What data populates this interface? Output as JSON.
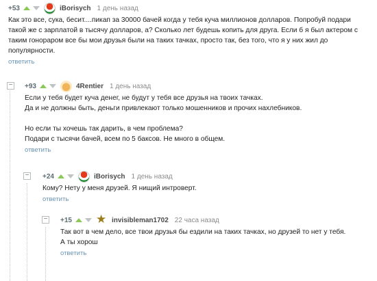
{
  "comments": [
    {
      "score": "+53",
      "user": "iBorisych",
      "time": "1 день назад",
      "lines": [
        "Как это все, сука, бесит....пикап за 30000 бачей когда у тебя куча миллионов долларов. Попробуй подари такой же с зарплатой в тысячу долларов, а? Сколько лет будешь копить для друга. Если б я был актером с таким гонораром все бы мои друзья были на таких тачках, просто так, без того, что я у них жил до популярности."
      ],
      "reply": "ответить"
    },
    {
      "score": "+93",
      "user": "4Rentier",
      "time": "1 день назад",
      "lines": [
        "Если у тебя будет куча денег, не будут у тебя все друзья на твоих тачках.",
        "Да и не должны быть, деньги привлекают только мошенников и прочих нахлебников.",
        "",
        "Но если ты хочешь так дарить, в чем проблема?",
        "Подари с тысячи бачей, всем по 5 баксов. Не много в общем."
      ],
      "reply": "ответить"
    },
    {
      "score": "+24",
      "user": "iBorisych",
      "time": "1 день назад",
      "lines": [
        "Кому? Нету у меня друзей. Я нищий интроверт."
      ],
      "reply": "ответить"
    },
    {
      "score": "+15",
      "user": "invisibleman1702",
      "time": "22 часа назад",
      "lines": [
        "Так вот в чем дело, все твои друзья бы ездили на таких тачках, но друзей то нет у тебя.",
        "А ты хорош"
      ],
      "reply": "ответить"
    }
  ],
  "collapse_symbol": "−"
}
